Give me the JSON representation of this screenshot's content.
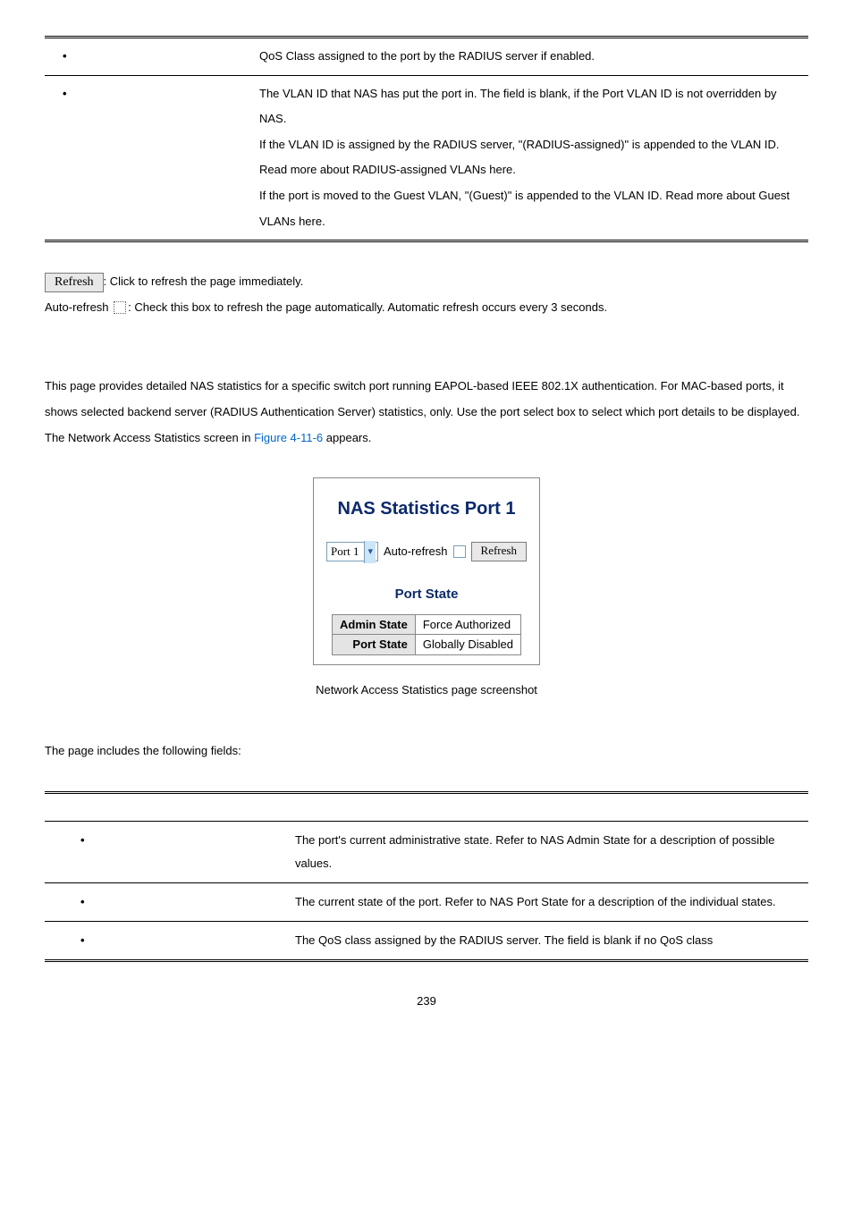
{
  "top_table": {
    "rows": [
      {
        "desc": "QoS Class assigned to the port by the RADIUS server if enabled."
      },
      {
        "desc": "The VLAN ID that NAS has put the port in. The field is blank, if the Port VLAN ID is not overridden by NAS.\nIf the VLAN ID is assigned by the RADIUS server, \"(RADIUS-assigned)\" is appended to the VLAN ID. Read more about RADIUS-assigned VLANs here.\nIf the port is moved to the Guest VLAN, \"(Guest)\" is appended to the VLAN ID. Read more about Guest VLANs here."
      }
    ]
  },
  "refresh": {
    "button_label": "Refresh",
    "click_text": ": Click to refresh the page immediately.",
    "auto_label": "Auto-refresh ",
    "auto_text": ": Check this box to refresh the page automatically. Automatic refresh occurs every 3 seconds."
  },
  "paragraph": {
    "pre": "This page provides detailed NAS statistics for a specific switch port running EAPOL-based IEEE 802.1X authentication. For MAC-based ports, it shows selected backend server (RADIUS Authentication Server) statistics, only. Use the port select box to select which port details to be displayed. The Network Access Statistics screen in ",
    "link": "Figure 4-11-6",
    "post": " appears."
  },
  "figure": {
    "title": "NAS Statistics  Port 1",
    "port_select": "Port 1",
    "autorefresh_label": "Auto-refresh",
    "refresh_btn": "Refresh",
    "sub_title": "Port State",
    "rows": [
      {
        "label": "Admin State",
        "value": "Force Authorized"
      },
      {
        "label": "Port State",
        "value": "Globally Disabled"
      }
    ],
    "caption": "Network Access Statistics page screenshot"
  },
  "fields_intro": "The page includes the following fields:",
  "fields_table": {
    "rows": [
      {
        "desc": "The port's current administrative state. Refer to NAS Admin State for a description of possible values."
      },
      {
        "desc": "The current state of the port. Refer to NAS Port State for a description of the individual states."
      },
      {
        "desc": "The QoS class assigned by the RADIUS server. The field is blank if no QoS class"
      }
    ]
  },
  "page_number": "239"
}
